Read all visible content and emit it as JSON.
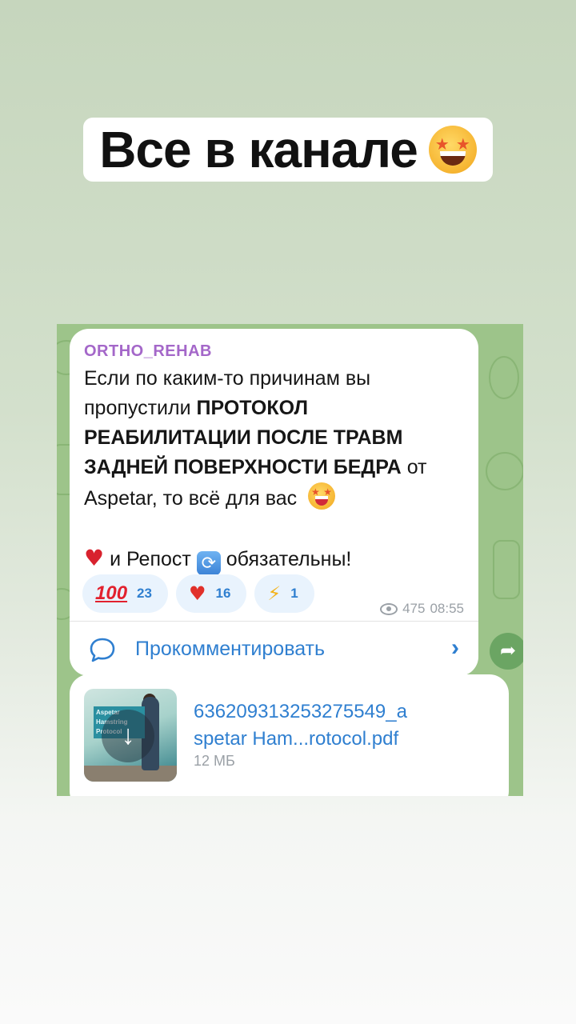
{
  "story": {
    "title": "Все в канале",
    "title_emoji": "star-struck-emoji"
  },
  "post": {
    "channel": "ORTHO_REHAB",
    "text_lines": [
      {
        "plain": "Если по каким-то причинам вы",
        "bold": ""
      },
      {
        "plain": "пропустили ",
        "bold": "ПРОТОКОЛ"
      },
      {
        "plain": "",
        "bold": "РЕАБИЛИТАЦИИ ПОСЛЕ ТРАВМ"
      },
      {
        "plain_after": " от",
        "bold": "ЗАДНЕЙ ПОВЕРХНОСТИ БЕДРА"
      },
      {
        "plain": "Aspetar, то всё для вас"
      }
    ],
    "call_to_action": {
      "part1": "и Репост",
      "part2": "обязательны!"
    },
    "reactions": [
      {
        "icon": "hundred-points-emoji",
        "count": "23"
      },
      {
        "icon": "heart-on-fire-emoji",
        "count": "16"
      },
      {
        "icon": "lightning-emoji",
        "count": "1"
      }
    ],
    "views": "475",
    "time": "08:55",
    "comment_label": "Прокомментировать"
  },
  "file": {
    "name_line1": "636209313253275549_a",
    "name_line2": "spetar Ham...rotocol.pdf",
    "size": "12 МБ",
    "thumb_label": "Aspetar Hamstring Protocol"
  },
  "colors": {
    "channel_name": "#a467c9",
    "link_blue": "#2f7fd0",
    "chat_background": "#9dc48a"
  }
}
